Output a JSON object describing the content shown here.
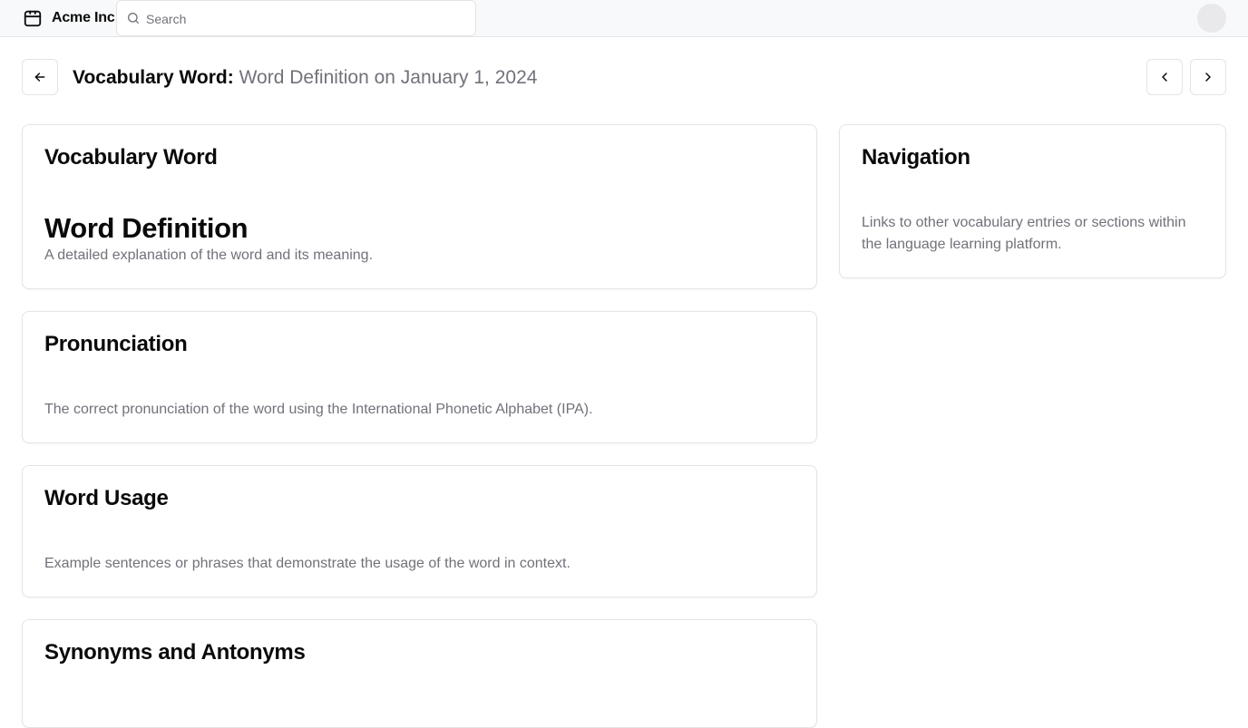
{
  "header": {
    "brand_name": "Acme Inc",
    "brand_icon": "package-icon",
    "search_placeholder": "Search",
    "search_value": ""
  },
  "title_bar": {
    "title_strong": "Vocabulary Word:",
    "title_muted": "Word Definition on January 1, 2024",
    "back_icon": "arrow-left-icon",
    "prev_icon": "chevron-left-icon",
    "next_icon": "chevron-right-icon"
  },
  "cards": {
    "vocabulary": {
      "heading": "Vocabulary Word",
      "word": "Word Definition",
      "description": "A detailed explanation of the word and its meaning."
    },
    "pronunciation": {
      "heading": "Pronunciation",
      "description": "The correct pronunciation of the word using the International Phonetic Alphabet (IPA)."
    },
    "usage": {
      "heading": "Word Usage",
      "description": "Example sentences or phrases that demonstrate the usage of the word in context."
    },
    "synonyms": {
      "heading": "Synonyms and Antonyms"
    },
    "navigation": {
      "heading": "Navigation",
      "description": "Links to other vocabulary entries or sections within the language learning platform."
    }
  },
  "colors": {
    "text_primary": "#0a0a0a",
    "text_muted": "#71717a",
    "border": "#e4e4e7",
    "topbar_bg": "#f8f9fa"
  }
}
